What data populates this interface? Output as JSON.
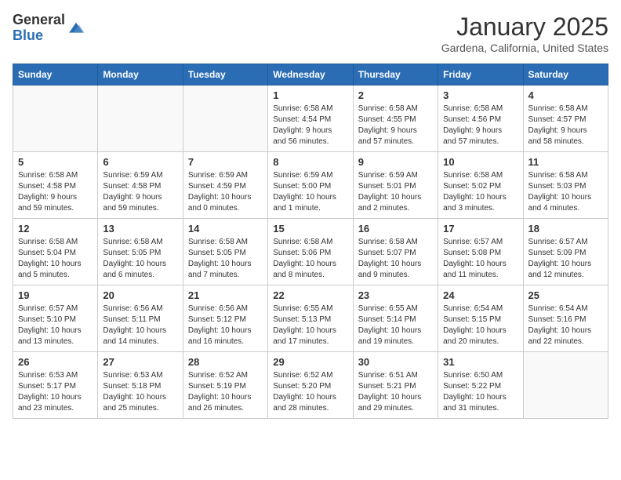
{
  "header": {
    "logo_general": "General",
    "logo_blue": "Blue",
    "month_year": "January 2025",
    "location": "Gardena, California, United States"
  },
  "weekdays": [
    "Sunday",
    "Monday",
    "Tuesday",
    "Wednesday",
    "Thursday",
    "Friday",
    "Saturday"
  ],
  "weeks": [
    [
      {
        "day": "",
        "info": ""
      },
      {
        "day": "",
        "info": ""
      },
      {
        "day": "",
        "info": ""
      },
      {
        "day": "1",
        "info": "Sunrise: 6:58 AM\nSunset: 4:54 PM\nDaylight: 9 hours\nand 56 minutes."
      },
      {
        "day": "2",
        "info": "Sunrise: 6:58 AM\nSunset: 4:55 PM\nDaylight: 9 hours\nand 57 minutes."
      },
      {
        "day": "3",
        "info": "Sunrise: 6:58 AM\nSunset: 4:56 PM\nDaylight: 9 hours\nand 57 minutes."
      },
      {
        "day": "4",
        "info": "Sunrise: 6:58 AM\nSunset: 4:57 PM\nDaylight: 9 hours\nand 58 minutes."
      }
    ],
    [
      {
        "day": "5",
        "info": "Sunrise: 6:58 AM\nSunset: 4:58 PM\nDaylight: 9 hours\nand 59 minutes."
      },
      {
        "day": "6",
        "info": "Sunrise: 6:59 AM\nSunset: 4:58 PM\nDaylight: 9 hours\nand 59 minutes."
      },
      {
        "day": "7",
        "info": "Sunrise: 6:59 AM\nSunset: 4:59 PM\nDaylight: 10 hours\nand 0 minutes."
      },
      {
        "day": "8",
        "info": "Sunrise: 6:59 AM\nSunset: 5:00 PM\nDaylight: 10 hours\nand 1 minute."
      },
      {
        "day": "9",
        "info": "Sunrise: 6:59 AM\nSunset: 5:01 PM\nDaylight: 10 hours\nand 2 minutes."
      },
      {
        "day": "10",
        "info": "Sunrise: 6:58 AM\nSunset: 5:02 PM\nDaylight: 10 hours\nand 3 minutes."
      },
      {
        "day": "11",
        "info": "Sunrise: 6:58 AM\nSunset: 5:03 PM\nDaylight: 10 hours\nand 4 minutes."
      }
    ],
    [
      {
        "day": "12",
        "info": "Sunrise: 6:58 AM\nSunset: 5:04 PM\nDaylight: 10 hours\nand 5 minutes."
      },
      {
        "day": "13",
        "info": "Sunrise: 6:58 AM\nSunset: 5:05 PM\nDaylight: 10 hours\nand 6 minutes."
      },
      {
        "day": "14",
        "info": "Sunrise: 6:58 AM\nSunset: 5:05 PM\nDaylight: 10 hours\nand 7 minutes."
      },
      {
        "day": "15",
        "info": "Sunrise: 6:58 AM\nSunset: 5:06 PM\nDaylight: 10 hours\nand 8 minutes."
      },
      {
        "day": "16",
        "info": "Sunrise: 6:58 AM\nSunset: 5:07 PM\nDaylight: 10 hours\nand 9 minutes."
      },
      {
        "day": "17",
        "info": "Sunrise: 6:57 AM\nSunset: 5:08 PM\nDaylight: 10 hours\nand 11 minutes."
      },
      {
        "day": "18",
        "info": "Sunrise: 6:57 AM\nSunset: 5:09 PM\nDaylight: 10 hours\nand 12 minutes."
      }
    ],
    [
      {
        "day": "19",
        "info": "Sunrise: 6:57 AM\nSunset: 5:10 PM\nDaylight: 10 hours\nand 13 minutes."
      },
      {
        "day": "20",
        "info": "Sunrise: 6:56 AM\nSunset: 5:11 PM\nDaylight: 10 hours\nand 14 minutes."
      },
      {
        "day": "21",
        "info": "Sunrise: 6:56 AM\nSunset: 5:12 PM\nDaylight: 10 hours\nand 16 minutes."
      },
      {
        "day": "22",
        "info": "Sunrise: 6:55 AM\nSunset: 5:13 PM\nDaylight: 10 hours\nand 17 minutes."
      },
      {
        "day": "23",
        "info": "Sunrise: 6:55 AM\nSunset: 5:14 PM\nDaylight: 10 hours\nand 19 minutes."
      },
      {
        "day": "24",
        "info": "Sunrise: 6:54 AM\nSunset: 5:15 PM\nDaylight: 10 hours\nand 20 minutes."
      },
      {
        "day": "25",
        "info": "Sunrise: 6:54 AM\nSunset: 5:16 PM\nDaylight: 10 hours\nand 22 minutes."
      }
    ],
    [
      {
        "day": "26",
        "info": "Sunrise: 6:53 AM\nSunset: 5:17 PM\nDaylight: 10 hours\nand 23 minutes."
      },
      {
        "day": "27",
        "info": "Sunrise: 6:53 AM\nSunset: 5:18 PM\nDaylight: 10 hours\nand 25 minutes."
      },
      {
        "day": "28",
        "info": "Sunrise: 6:52 AM\nSunset: 5:19 PM\nDaylight: 10 hours\nand 26 minutes."
      },
      {
        "day": "29",
        "info": "Sunrise: 6:52 AM\nSunset: 5:20 PM\nDaylight: 10 hours\nand 28 minutes."
      },
      {
        "day": "30",
        "info": "Sunrise: 6:51 AM\nSunset: 5:21 PM\nDaylight: 10 hours\nand 29 minutes."
      },
      {
        "day": "31",
        "info": "Sunrise: 6:50 AM\nSunset: 5:22 PM\nDaylight: 10 hours\nand 31 minutes."
      },
      {
        "day": "",
        "info": ""
      }
    ]
  ]
}
